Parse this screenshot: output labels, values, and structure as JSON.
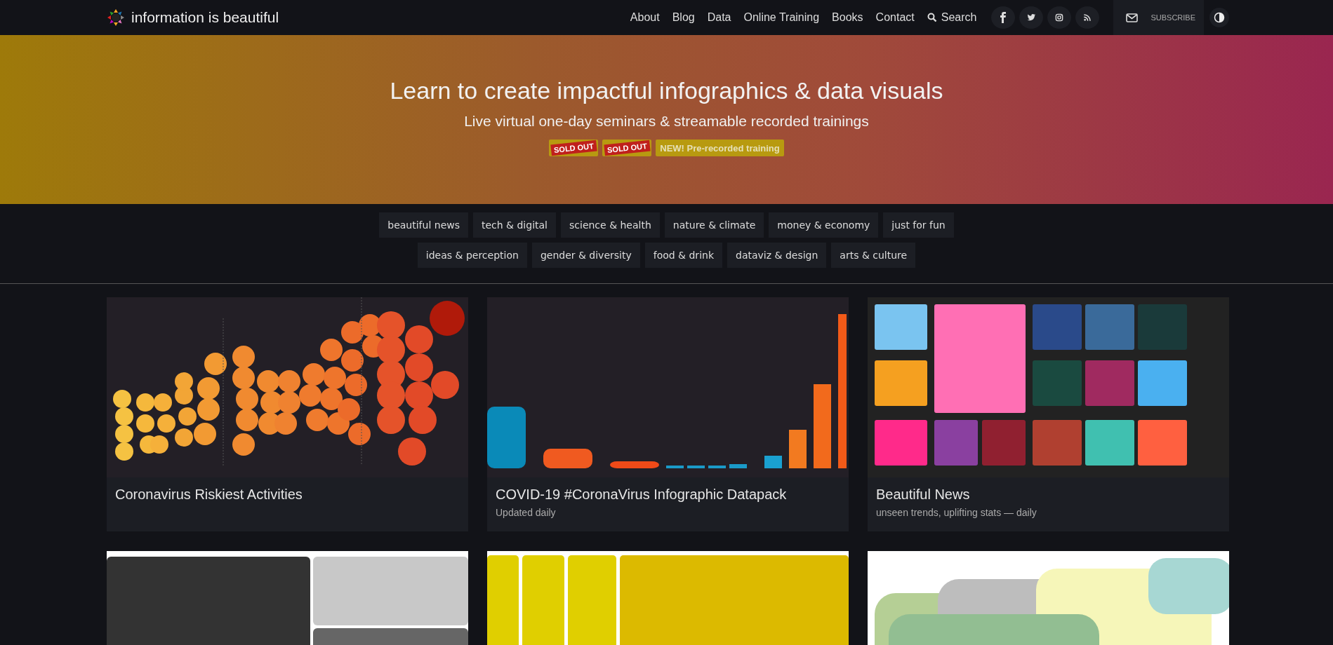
{
  "header": {
    "logo": "information is beautiful",
    "nav": [
      "About",
      "Blog",
      "Data",
      "Online Training",
      "Books",
      "Contact"
    ],
    "search": "Search",
    "social": [
      {
        "kind": "facebook"
      },
      {
        "kind": "twitter"
      },
      {
        "kind": "instagram"
      },
      {
        "kind": "rss"
      }
    ],
    "subscribe": "SUBSCRIBE"
  },
  "banner": {
    "title": "Learn to create impactful infographics & data visuals",
    "subtitle": "Live virtual one-day seminars & streamable recorded trainings",
    "badges": [
      {
        "kind": "soldout",
        "label": "SOLD OUT"
      },
      {
        "kind": "soldout",
        "label": "SOLD OUT"
      },
      {
        "kind": "plain",
        "label": "NEW! Pre-recorded training"
      }
    ]
  },
  "tags": [
    [
      "beautiful news",
      "tech & digital",
      "science & health",
      "nature & climate",
      "money & economy",
      "just for fun"
    ],
    [
      "ideas & perception",
      "gender & diversity",
      "food & drink",
      "dataviz & design",
      "arts & culture"
    ]
  ],
  "cards": [
    {
      "kind": "bubbles",
      "title": "Coronavirus Riskiest Activities"
    },
    {
      "kind": "bars",
      "title": "COVID-19 #CoronaVirus Infographic Datapack",
      "subtitle": "Updated daily"
    },
    {
      "kind": "mosaic",
      "title": "Beautiful News",
      "subtitle": "unseen trends, uplifting stats — daily"
    },
    {
      "kind": "treemap-grey"
    },
    {
      "kind": "treemap-yellow"
    },
    {
      "kind": "venn"
    }
  ]
}
